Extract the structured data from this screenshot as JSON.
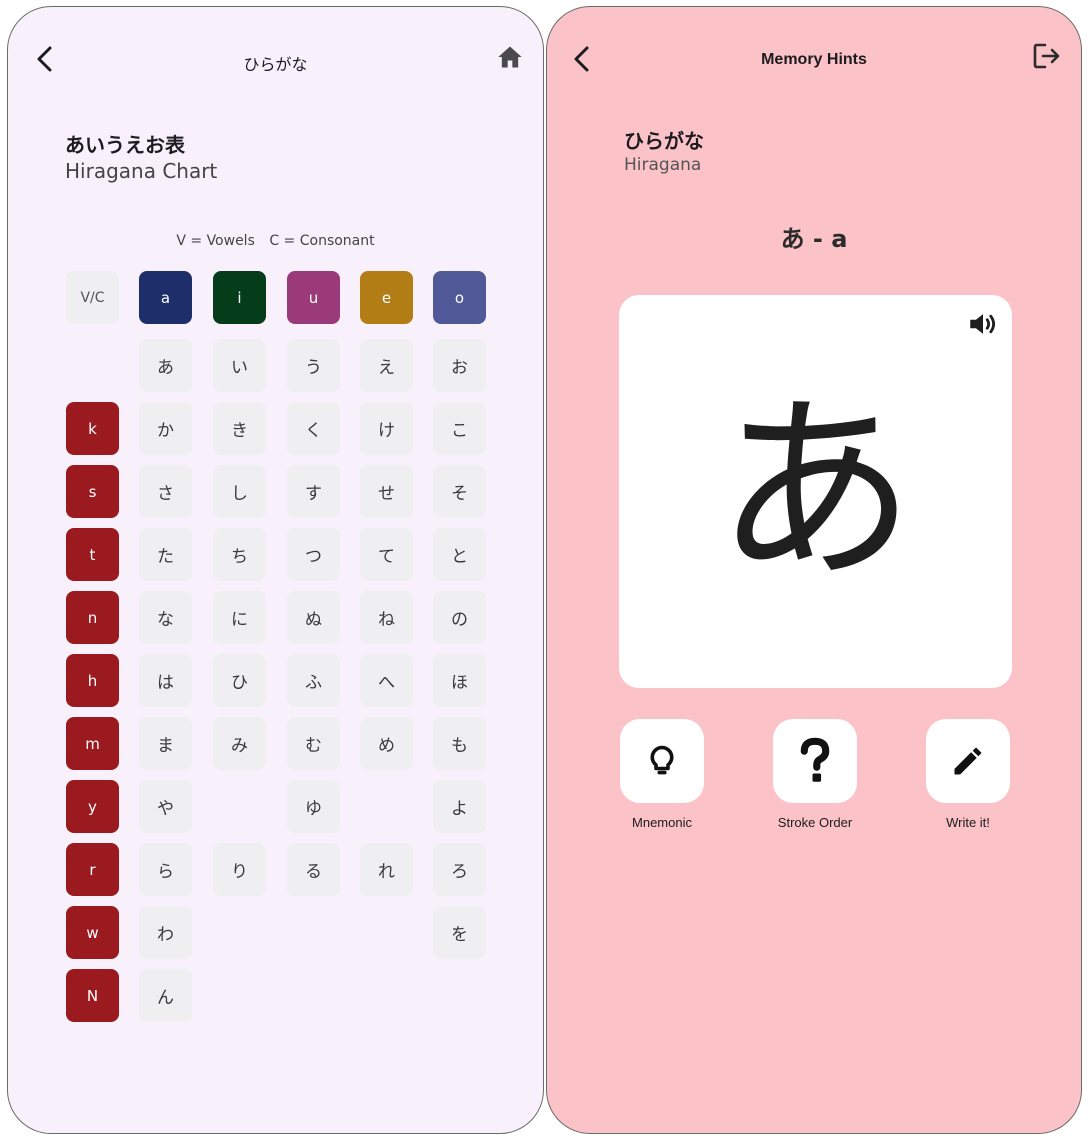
{
  "left_screen": {
    "title": "ひらがな",
    "heading_jp": "あいうえお表",
    "heading_en": "Hiragana Chart",
    "legend": {
      "vowels": "V = Vowels",
      "consonants": "C = Consonant"
    },
    "corner_label": "V/C",
    "vowels": [
      {
        "label": "a",
        "color": "#1d2e6b"
      },
      {
        "label": "i",
        "color": "#053c1a"
      },
      {
        "label": "u",
        "color": "#9b3a79"
      },
      {
        "label": "e",
        "color": "#b27d14"
      },
      {
        "label": "o",
        "color": "#505898"
      }
    ],
    "consonant_color": "#9b1a1f",
    "rows": [
      {
        "consonant": "",
        "kana": [
          "あ",
          "い",
          "う",
          "え",
          "お"
        ]
      },
      {
        "consonant": "k",
        "kana": [
          "か",
          "き",
          "く",
          "け",
          "こ"
        ]
      },
      {
        "consonant": "s",
        "kana": [
          "さ",
          "し",
          "す",
          "せ",
          "そ"
        ]
      },
      {
        "consonant": "t",
        "kana": [
          "た",
          "ち",
          "つ",
          "て",
          "と"
        ]
      },
      {
        "consonant": "n",
        "kana": [
          "な",
          "に",
          "ぬ",
          "ね",
          "の"
        ]
      },
      {
        "consonant": "h",
        "kana": [
          "は",
          "ひ",
          "ふ",
          "へ",
          "ほ"
        ]
      },
      {
        "consonant": "m",
        "kana": [
          "ま",
          "み",
          "む",
          "め",
          "も"
        ]
      },
      {
        "consonant": "y",
        "kana": [
          "や",
          "",
          "ゆ",
          "",
          "よ"
        ]
      },
      {
        "consonant": "r",
        "kana": [
          "ら",
          "り",
          "る",
          "れ",
          "ろ"
        ]
      },
      {
        "consonant": "w",
        "kana": [
          "わ",
          "",
          "",
          "",
          "を"
        ]
      },
      {
        "consonant": "N",
        "kana": [
          "ん",
          "",
          "",
          "",
          ""
        ]
      }
    ],
    "icons": {
      "back": "back-arrow-icon",
      "home": "home-icon"
    },
    "background": "#f8f1fb"
  },
  "right_screen": {
    "title": "Memory Hints",
    "heading_jp": "ひらがな",
    "heading_en": "Hiragana",
    "current": "あ - a",
    "big_char": "あ",
    "actions": [
      {
        "label": "Mnemonic",
        "icon": "lightbulb-icon"
      },
      {
        "label": "Stroke Order",
        "icon": "question-mark-icon"
      },
      {
        "label": "Write it!",
        "icon": "pencil-icon"
      }
    ],
    "icons": {
      "back": "back-arrow-icon",
      "exit": "logout-icon",
      "sound": "speaker-icon"
    },
    "background": "#fbc2c7"
  }
}
